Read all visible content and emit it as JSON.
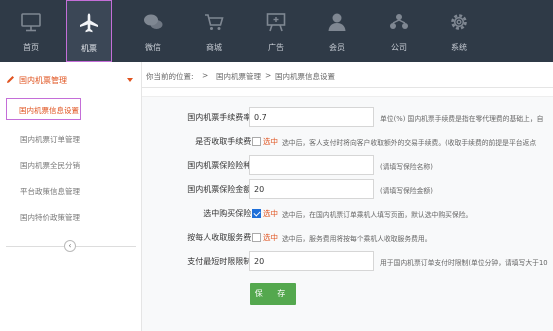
{
  "nav": [
    {
      "key": "home",
      "label": "首页",
      "icon": "monitor-icon",
      "active": false
    },
    {
      "key": "ticket",
      "label": "机票",
      "icon": "airplane-icon",
      "active": true
    },
    {
      "key": "wechat",
      "label": "微信",
      "icon": "wechat-icon",
      "active": false
    },
    {
      "key": "mall",
      "label": "商城",
      "icon": "cart-icon",
      "active": false
    },
    {
      "key": "ads",
      "label": "广告",
      "icon": "billboard-icon",
      "active": false
    },
    {
      "key": "member",
      "label": "会员",
      "icon": "user-icon",
      "active": false
    },
    {
      "key": "company",
      "label": "公司",
      "icon": "company-icon",
      "active": false
    },
    {
      "key": "system",
      "label": "系统",
      "icon": "gear-icon",
      "active": false
    }
  ],
  "sidebar": {
    "section_title": "国内机票管理",
    "active_item": "国内机票信息设置",
    "items": [
      "国内机票订单管理",
      "国内机票全民分销",
      "平台政策信息管理",
      "国内特价政策管理"
    ]
  },
  "breadcrumb": {
    "prefix": "你当前的位置:",
    "sep": ">",
    "level1": "国内机票管理",
    "level2": "国内机票信息设置"
  },
  "form": {
    "fee_rate": {
      "label": "国内机票手续费率:",
      "value": "0.7",
      "hint": "单位(%) 国内机票手续费是指在零代理费的基础上，自"
    },
    "charge_fee": {
      "label": "是否收取手续费:",
      "checkbox_label": "选中",
      "checked": false,
      "desc": "选中后，客人支付时将向客户收取额外的交易手续费。(收取手续费的前提是平台返点"
    },
    "insurance_type": {
      "label": "国内机票保险险种:",
      "value": "",
      "hint": "(请填写保险名称)"
    },
    "insurance_amount": {
      "label": "国内机票保险金额:",
      "value": "20",
      "hint": "(请填写保险金额)"
    },
    "force_insurance": {
      "label": "选中购买保险:",
      "checkbox_label": "选中",
      "checked": true,
      "desc": "选中后，在国内机票订单乘机人填写页面，默认选中购买保险。"
    },
    "service_fee": {
      "label": "按每人收取服务费:",
      "checkbox_label": "选中",
      "checked": false,
      "desc": "选中后，服务费用将按每个乘机人收取服务费用。"
    },
    "payment_limit": {
      "label": "支付最短时限限制:",
      "value": "20",
      "hint": "用于国内机票订单支付时限制(单位分钟，请填写大于10"
    },
    "save_label": "保 存"
  }
}
